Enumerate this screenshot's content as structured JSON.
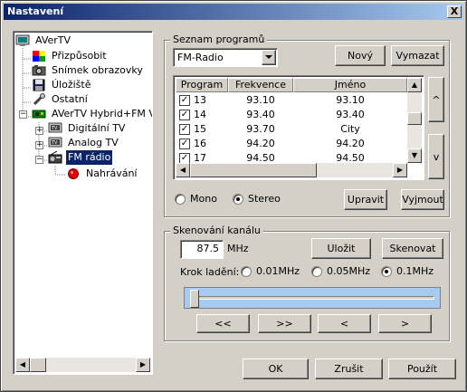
{
  "window": {
    "title": "Nastavení",
    "close_label": "X"
  },
  "tree": {
    "items": [
      {
        "label": "AVerTV",
        "icon": "monitor-icon"
      },
      {
        "label": "Přizpůsobit",
        "icon": "customize-icon"
      },
      {
        "label": "Snímek obrazovky",
        "icon": "camera-icon"
      },
      {
        "label": "Úložiště",
        "icon": "floppy-disk-icon"
      },
      {
        "label": "Ostatní",
        "icon": "wrench-icon"
      },
      {
        "label": "AVerTV Hybrid+FM Vo",
        "icon": "tuner-card-icon"
      },
      {
        "label": "Digitální TV",
        "icon": "tv-icon"
      },
      {
        "label": "Analog TV",
        "icon": "tv-icon"
      },
      {
        "label": "FM rádio",
        "icon": "radio-icon"
      },
      {
        "label": "Nahrávání",
        "icon": "record-icon"
      }
    ]
  },
  "programs": {
    "group_title": "Seznam programů",
    "source_selected": "FM-Radio",
    "new_button": "Nový",
    "delete_button": "Vymazat",
    "columns": [
      "Program",
      "Frekvence",
      "Jméno"
    ],
    "rows": [
      {
        "program": "13",
        "frequency": "93.10",
        "name": "93.10",
        "checked": true
      },
      {
        "program": "14",
        "frequency": "93.40",
        "name": "93.40",
        "checked": true
      },
      {
        "program": "15",
        "frequency": "93.70",
        "name": "City",
        "checked": true
      },
      {
        "program": "16",
        "frequency": "94.20",
        "name": "94.20",
        "checked": true
      },
      {
        "program": "17",
        "frequency": "94.50",
        "name": "94.50",
        "checked": true
      }
    ],
    "up_button": "^",
    "down_button": "v",
    "mono_label": "Mono",
    "stereo_label": "Stereo",
    "audio_mode": "Stereo",
    "edit_button": "Upravit",
    "cut_button": "Vyjmout"
  },
  "scan": {
    "group_title": "Skenování kanálu",
    "frequency_value": "87.5",
    "frequency_unit": "MHz",
    "save_button": "Uložit",
    "scan_button": "Skenovat",
    "step_label": "Krok ladění:",
    "step_options": [
      "0.01MHz",
      "0.05MHz",
      "0.1MHz"
    ],
    "step_selected": "0.1MHz",
    "slider_level": 0.0,
    "nav_buttons": [
      "<<",
      ">>",
      "<",
      ">"
    ]
  },
  "footer": {
    "ok_button": "OK",
    "cancel_button": "Zrušit",
    "apply_button": "Použít"
  },
  "colors": {
    "title_start": "#0a246a",
    "title_end": "#a6caf0",
    "face": "#d4d0c8",
    "selection": "#0a246a",
    "slider_bg": "#a6caf0"
  }
}
